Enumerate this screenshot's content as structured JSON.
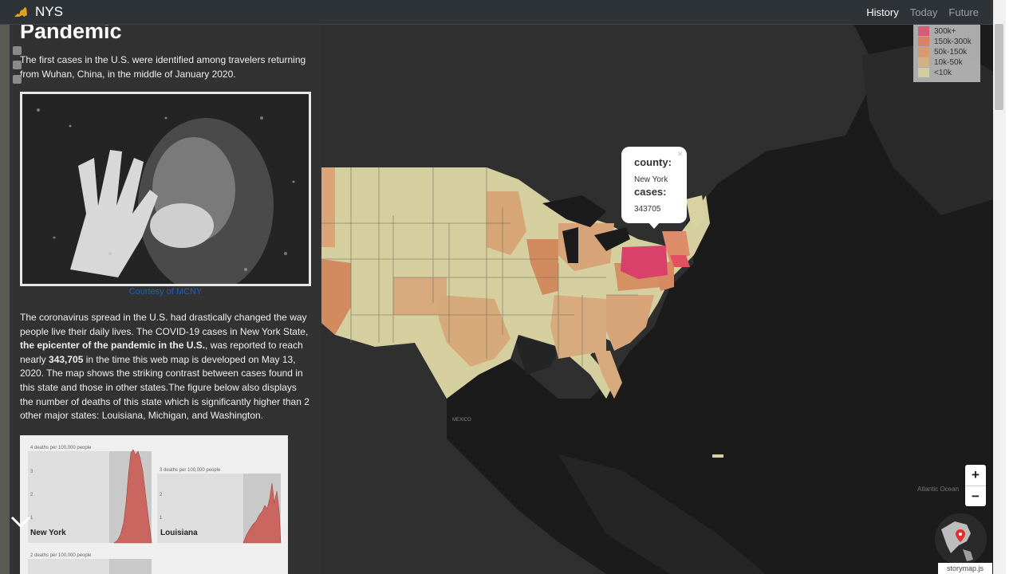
{
  "header": {
    "brand": "NYS",
    "nav": [
      "History",
      "Today",
      "Future"
    ],
    "active_nav": "History"
  },
  "panel": {
    "title": "Pandemic",
    "intro": "The first cases in the U.S. were identified among travelers returning from Wuhan, China, in the middle of January 2020.",
    "photo_credit": "Courtesy of MCNY",
    "body_parts": [
      "The coronavirus spread in the U.S. had drastically changed the way people live their daily lives. The COVID-19 cases in New York State, ",
      "the epicenter of the pandemic in the U.S.",
      ", was reported to reach nearly ",
      "343,705",
      " in the time this web map is developed on May 13, 2020. The map shows the striking contrast between cases found in this state and those in other states.The figure below also displays the number of deaths of this state which is significantly higher than 2 other major states: Louisiana, Michigan, and Washington."
    ],
    "charts": [
      {
        "state": "New York",
        "ylabel": "4 deaths per 100,000 people",
        "ticks": [
          "3",
          "2",
          "1"
        ]
      },
      {
        "state": "Louisiana",
        "ylabel": "3 deaths per 100,000 people",
        "ticks": [
          "2",
          "1"
        ]
      },
      {
        "state": "",
        "ylabel": "2 deaths per 100,000 people",
        "ticks": []
      }
    ]
  },
  "legend": {
    "items": [
      {
        "label": "300k+",
        "color": "#e0607a"
      },
      {
        "label": "150k-300k",
        "color": "#e4876a"
      },
      {
        "label": "50k-150k",
        "color": "#e1a071"
      },
      {
        "label": "10k-50k",
        "color": "#dcb98a"
      },
      {
        "label": "<10k",
        "color": "#dcd6a8"
      }
    ]
  },
  "popup": {
    "county_label": "county:",
    "county_value": "New York",
    "cases_label": "cases:",
    "cases_value": "343705",
    "close": "×"
  },
  "map_labels": {
    "mexico": "MEXICO",
    "ocean": "Atlantic Ocean"
  },
  "zoom": {
    "in": "+",
    "out": "−"
  },
  "attribution": "storymap.js",
  "colors": {
    "accent_link": "#1f5fbf",
    "ny_fill": "#d9406a"
  }
}
